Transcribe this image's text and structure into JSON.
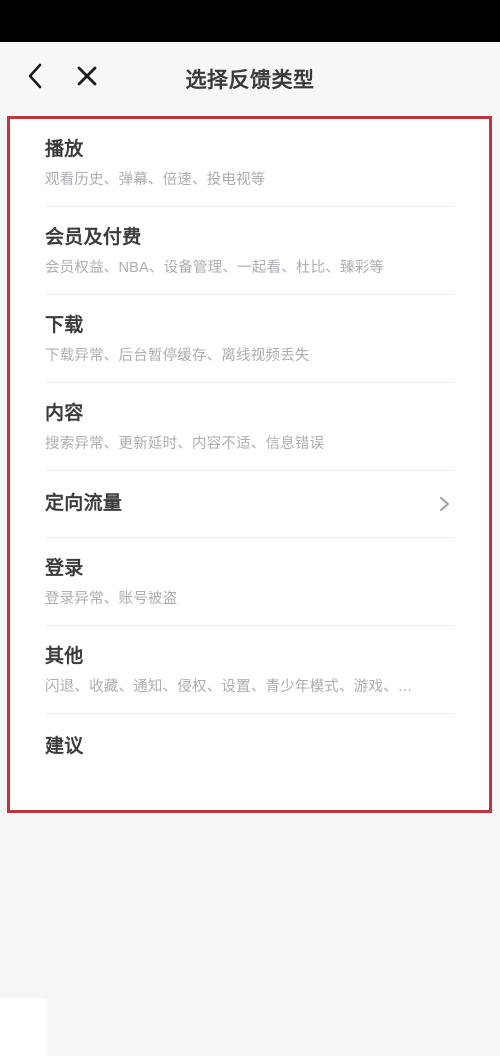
{
  "status_bar": {
    "label": "status-bar"
  },
  "header": {
    "title": "选择反馈类型",
    "back_icon": "chevron-left-icon",
    "close_icon": "close-icon"
  },
  "colors": {
    "annotation_red": "#c0343d",
    "page_background": "#f5f6f8",
    "card_background": "#ffffff",
    "title_text": "#3c3c3e",
    "subtitle_text": "#adadb2",
    "divider": "#ededf0",
    "status_bar": "#000000"
  },
  "list": {
    "items": [
      {
        "title": "播放",
        "subtitle": "观看历史、弹幕、倍速、投电视等",
        "has_chevron": false
      },
      {
        "title": "会员及付费",
        "subtitle": "会员权益、NBA、设备管理、一起看、杜比、臻彩等",
        "has_chevron": false
      },
      {
        "title": "下载",
        "subtitle": "下载异常、后台暂停缓存、离线视频丢失",
        "has_chevron": false
      },
      {
        "title": "内容",
        "subtitle": "搜索异常、更新延时、内容不适、信息错误",
        "has_chevron": false
      },
      {
        "title": "定向流量",
        "subtitle": "",
        "has_chevron": true
      },
      {
        "title": "登录",
        "subtitle": "登录异常、账号被盗",
        "has_chevron": false
      },
      {
        "title": "其他",
        "subtitle": "闪退、收藏、通知、侵权、设置、青少年模式、游戏、…",
        "has_chevron": false
      },
      {
        "title": "建议",
        "subtitle": "",
        "has_chevron": false
      }
    ]
  }
}
